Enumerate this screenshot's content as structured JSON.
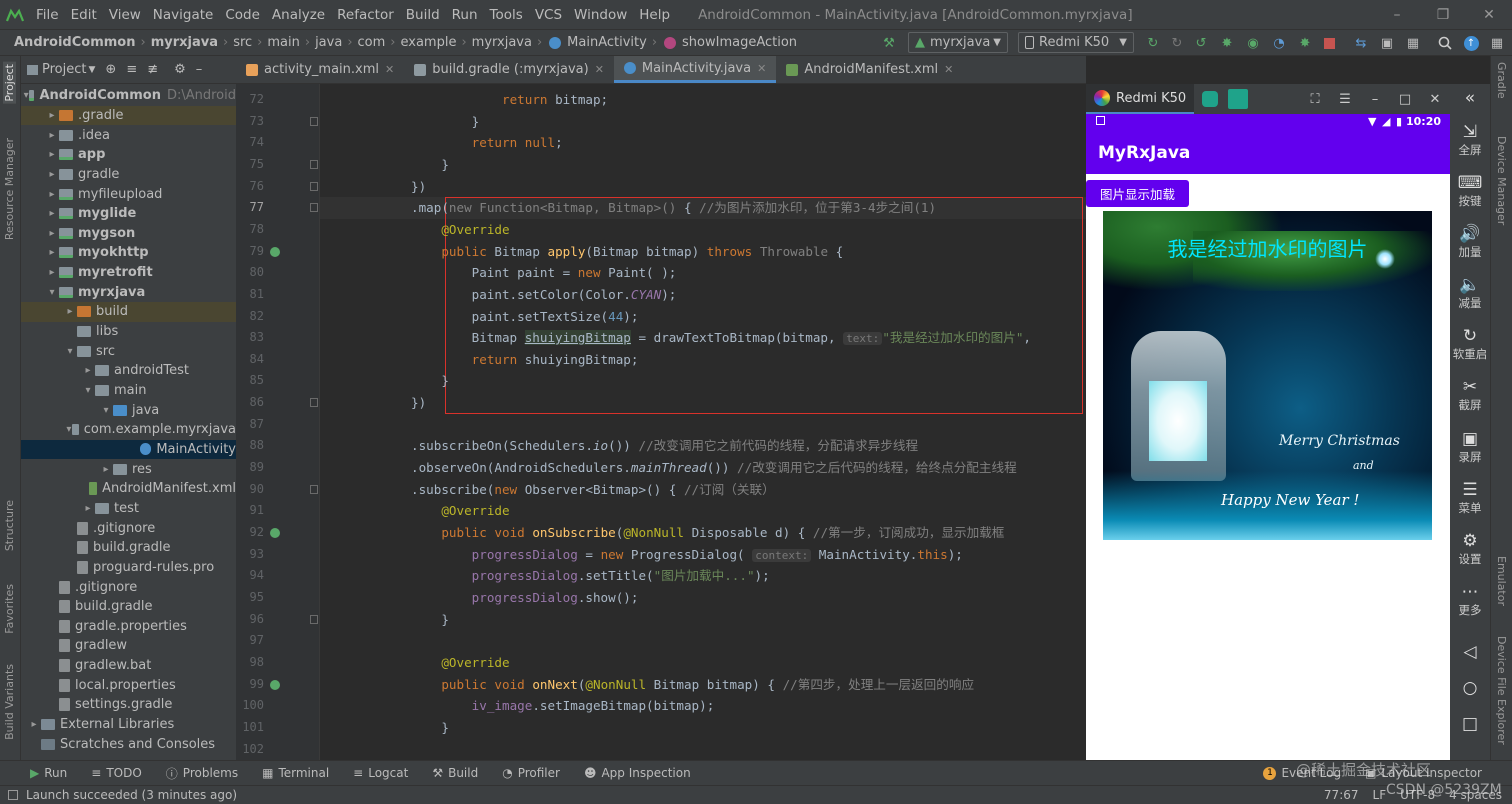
{
  "menu": {
    "items": [
      "File",
      "Edit",
      "View",
      "Navigate",
      "Code",
      "Analyze",
      "Refactor",
      "Build",
      "Run",
      "Tools",
      "VCS",
      "Window",
      "Help"
    ],
    "window_title": "AndroidCommon - MainActivity.java [AndroidCommon.myrxjava]"
  },
  "nav": {
    "breadcrumbs": [
      "AndroidCommon",
      "myrxjava",
      "src",
      "main",
      "java",
      "com",
      "example",
      "myrxjava",
      "MainActivity",
      "showImageAction"
    ],
    "run_config": "myrxjava",
    "device": "Redmi K50"
  },
  "project": {
    "header": "Project",
    "root_path": "D:\\Android",
    "tree": [
      {
        "label": "AndroidCommon",
        "indent": 0,
        "arrow": "down",
        "icon": "mod",
        "bold": true,
        "extra": "D:\\Android"
      },
      {
        "label": ".gradle",
        "indent": 1,
        "arrow": "right",
        "icon": "orange",
        "hl": "gold"
      },
      {
        "label": ".idea",
        "indent": 1,
        "arrow": "right",
        "icon": "plain"
      },
      {
        "label": "app",
        "indent": 1,
        "arrow": "right",
        "icon": "mod",
        "bold": true
      },
      {
        "label": "gradle",
        "indent": 1,
        "arrow": "right",
        "icon": "plain"
      },
      {
        "label": "myfileupload",
        "indent": 1,
        "arrow": "right",
        "icon": "mod"
      },
      {
        "label": "myglide",
        "indent": 1,
        "arrow": "right",
        "icon": "mod",
        "bold": true
      },
      {
        "label": "mygson",
        "indent": 1,
        "arrow": "right",
        "icon": "mod",
        "bold": true
      },
      {
        "label": "myokhttp",
        "indent": 1,
        "arrow": "right",
        "icon": "mod",
        "bold": true
      },
      {
        "label": "myretrofit",
        "indent": 1,
        "arrow": "right",
        "icon": "mod",
        "bold": true
      },
      {
        "label": "myrxjava",
        "indent": 1,
        "arrow": "down",
        "icon": "mod",
        "bold": true
      },
      {
        "label": "build",
        "indent": 2,
        "arrow": "right",
        "icon": "orange",
        "hl": "gold"
      },
      {
        "label": "libs",
        "indent": 2,
        "arrow": "",
        "icon": "plain"
      },
      {
        "label": "src",
        "indent": 2,
        "arrow": "down",
        "icon": "plain"
      },
      {
        "label": "androidTest",
        "indent": 3,
        "arrow": "right",
        "icon": "plain"
      },
      {
        "label": "main",
        "indent": 3,
        "arrow": "down",
        "icon": "plain"
      },
      {
        "label": "java",
        "indent": 4,
        "arrow": "down",
        "icon": "blue"
      },
      {
        "label": "com.example.myrxjava",
        "indent": 5,
        "arrow": "down",
        "icon": "plain"
      },
      {
        "label": "MainActivity",
        "indent": 6,
        "arrow": "",
        "icon": "class",
        "hl": "sel"
      },
      {
        "label": "res",
        "indent": 4,
        "arrow": "right",
        "icon": "plain"
      },
      {
        "label": "AndroidManifest.xml",
        "indent": 4,
        "arrow": "",
        "icon": "green"
      },
      {
        "label": "test",
        "indent": 3,
        "arrow": "right",
        "icon": "plain"
      },
      {
        "label": ".gitignore",
        "indent": 2,
        "arrow": "",
        "icon": "file"
      },
      {
        "label": "build.gradle",
        "indent": 2,
        "arrow": "",
        "icon": "file"
      },
      {
        "label": "proguard-rules.pro",
        "indent": 2,
        "arrow": "",
        "icon": "file"
      },
      {
        "label": ".gitignore",
        "indent": 1,
        "arrow": "",
        "icon": "file"
      },
      {
        "label": "build.gradle",
        "indent": 1,
        "arrow": "",
        "icon": "file"
      },
      {
        "label": "gradle.properties",
        "indent": 1,
        "arrow": "",
        "icon": "file"
      },
      {
        "label": "gradlew",
        "indent": 1,
        "arrow": "",
        "icon": "file"
      },
      {
        "label": "gradlew.bat",
        "indent": 1,
        "arrow": "",
        "icon": "file"
      },
      {
        "label": "local.properties",
        "indent": 1,
        "arrow": "",
        "icon": "file"
      },
      {
        "label": "settings.gradle",
        "indent": 1,
        "arrow": "",
        "icon": "file"
      },
      {
        "label": "External Libraries",
        "indent": 0,
        "arrow": "right",
        "icon": "lib"
      },
      {
        "label": "Scratches and Consoles",
        "indent": 0,
        "arrow": "",
        "icon": "scratch"
      }
    ]
  },
  "left_stripe": {
    "project": "Project",
    "resource_manager": "Resource Manager",
    "structure": "Structure",
    "favorites": "Favorites",
    "build_variants": "Build Variants"
  },
  "right_stripe": {
    "gradle": "Gradle",
    "device_manager": "Device Manager",
    "emulator": "Emulator",
    "device_file_explorer": "Device File Explorer"
  },
  "tabs": [
    {
      "label": "activity_main.xml",
      "color": "#e8a15a",
      "active": false
    },
    {
      "label": "build.gradle (:myrxjava)",
      "color": "#8e9aa0",
      "active": false
    },
    {
      "label": "MainActivity.java",
      "color": "#4a8ec9",
      "active": true
    },
    {
      "label": "AndroidManifest.xml",
      "color": "#6a9955",
      "active": false
    }
  ],
  "code": {
    "lines": [
      {
        "n": "72",
        "html": "                        <span class='kw'>return</span> bitmap;"
      },
      {
        "n": "73",
        "html": "                    }"
      },
      {
        "n": "74",
        "html": "                    <span class='kw'>return null</span>;"
      },
      {
        "n": "75",
        "html": "                }"
      },
      {
        "n": "76",
        "html": "            })"
      },
      {
        "n": "77",
        "html": "            .map(<span class='cm'>new Function&lt;Bitmap, Bitmap&gt;()</span> { <span class='cm'>//为图片添加水印，位于第3-4步之间(1)</span>"
      },
      {
        "n": "78",
        "html": "                <span class='an'>@Override</span>"
      },
      {
        "n": "79",
        "html": "                <span class='kw'>public</span> Bitmap <span class='fn'>apply</span>(Bitmap bitmap) <span class='kw'>throws</span> <span class='cm'>Throwable</span> {"
      },
      {
        "n": "80",
        "html": "                    Paint paint = <span class='kw'>new</span> Paint( );"
      },
      {
        "n": "81",
        "html": "                    paint.setColor(Color.<span class='fd it'>CYAN</span>);"
      },
      {
        "n": "82",
        "html": "                    paint.setTextSize(<span class='nu'>44</span>);"
      },
      {
        "n": "83",
        "html": "                    Bitmap <span style='background:#344134;text-decoration:underline'>shuiyingBitmap</span> = drawTextToBitmap(bitmap, <span class='hint'>text:</span><span class='st'>\"我是经过加水印的图片\"</span>,"
      },
      {
        "n": "84",
        "html": "                    <span class='kw'>return</span> shuiyingBitmap;"
      },
      {
        "n": "85",
        "html": "                }"
      },
      {
        "n": "86",
        "html": "            })"
      },
      {
        "n": "87",
        "html": ""
      },
      {
        "n": "88",
        "html": "            .subscribeOn(Schedulers.<span class='it'>io</span>()) <span class='cm'>//改变调用它之前代码的线程，分配请求异步线程</span>"
      },
      {
        "n": "89",
        "html": "            .observeOn(AndroidSchedulers.<span class='it'>mainThread</span>()) <span class='cm'>//改变调用它之后代码的线程，给终点分配主线程</span>"
      },
      {
        "n": "90",
        "html": "            .subscribe(<span class='kw'>new</span> Observer&lt;Bitmap&gt;() { <span class='cm'>//订阅（关联）</span>"
      },
      {
        "n": "91",
        "html": "                <span class='an'>@Override</span>"
      },
      {
        "n": "92",
        "html": "                <span class='kw'>public void</span> <span class='fn'>onSubscribe</span>(<span class='an'>@NonNull</span> Disposable d) { <span class='cm'>//第一步，订阅成功，显示加载框</span>"
      },
      {
        "n": "93",
        "html": "                    <span class='fd'>progressDialog</span> = <span class='kw'>new</span> ProgressDialog( <span class='hint'>context:</span> MainActivity.<span class='kw'>this</span>);"
      },
      {
        "n": "94",
        "html": "                    <span class='fd'>progressDialog</span>.setTitle(<span class='st'>\"图片加载中...\"</span>);"
      },
      {
        "n": "95",
        "html": "                    <span class='fd'>progressDialog</span>.show();"
      },
      {
        "n": "96",
        "html": "                }"
      },
      {
        "n": "97",
        "html": ""
      },
      {
        "n": "98",
        "html": "                <span class='an'>@Override</span>"
      },
      {
        "n": "99",
        "html": "                <span class='kw'>public void</span> <span class='fn'>onNext</span>(<span class='an'>@NonNull</span> Bitmap bitmap) { <span class='cm'>//第四步，处理上一层返回的响应</span>"
      },
      {
        "n": "100",
        "html": "                    <span class='fd'>iv_image</span>.setImageBitmap(bitmap);"
      },
      {
        "n": "101",
        "html": "                }"
      },
      {
        "n": "102",
        "html": ""
      }
    ]
  },
  "emulator": {
    "device_tab": "Redmi K50",
    "time": "10:20",
    "app_title": "MyRxJava",
    "button_label": "图片显示加载",
    "watermark": "我是经过加水印的图片",
    "card_line1": "Merry Christmas",
    "card_line2": "and",
    "card_line3": "Happy New Year !",
    "side_buttons": [
      "全屏",
      "按键",
      "加量",
      "减量",
      "软重启",
      "截屏",
      "录屏",
      "菜单",
      "设置",
      "更多"
    ]
  },
  "toolwindows": [
    "Run",
    "TODO",
    "Problems",
    "Terminal",
    "Logcat",
    "Build",
    "Profiler",
    "App Inspection"
  ],
  "toolwindows_right": [
    "Event Log",
    "Layout Inspector"
  ],
  "status": {
    "message": "Launch succeeded (3 minutes ago)",
    "position": "77:67",
    "line_sep": "LF",
    "encoding": "UTF-8",
    "indent": "4 spaces",
    "watermark": "@稀土掘金技术社区",
    "watermark2": "CSDN @5239ZM"
  },
  "colors": {
    "accent": "#6200ee",
    "selection": "#0d293e",
    "highlight_box": "#d9322b"
  }
}
